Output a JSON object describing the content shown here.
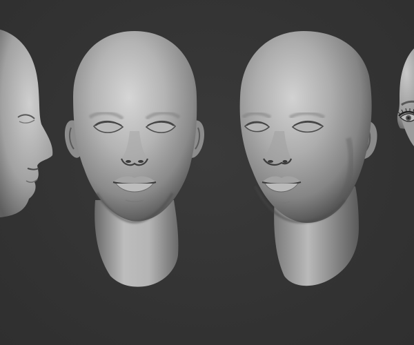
{
  "scene": {
    "background_color": "#353535",
    "sculpt_material_color": "#9a9a9a",
    "views": [
      {
        "name": "left-profile",
        "icon": "head-profile-left"
      },
      {
        "name": "front",
        "icon": "head-front"
      },
      {
        "name": "three-quarter",
        "icon": "head-three-quarter"
      },
      {
        "name": "right-profile-partial",
        "icon": "head-profile-right"
      }
    ]
  }
}
